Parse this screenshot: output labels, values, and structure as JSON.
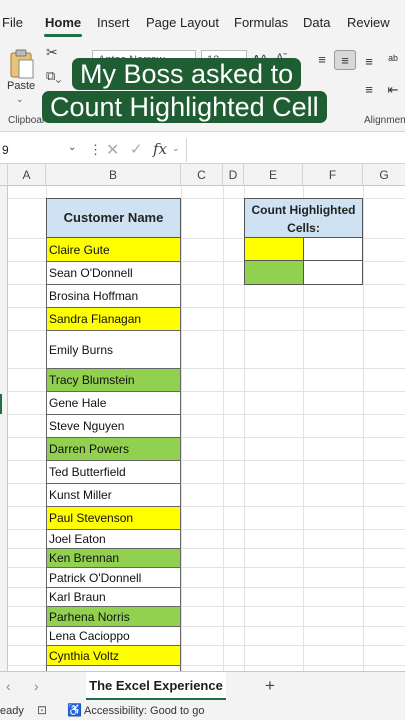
{
  "ribbon_tabs": [
    {
      "label": "File"
    },
    {
      "label": "Home"
    },
    {
      "label": "Insert"
    },
    {
      "label": "Page Layout"
    },
    {
      "label": "Formulas"
    },
    {
      "label": "Data"
    },
    {
      "label": "Review"
    }
  ],
  "active_tab": "Home",
  "ribbon": {
    "paste_label": "Paste",
    "font_name": "Aptos Narrow",
    "font_size": "12",
    "clipboard_label": "Clipboar",
    "alignment_label": "Alignmen"
  },
  "overlay": {
    "line1": "My Boss asked to",
    "line2": "Count Highlighted Cell"
  },
  "formula_bar": {
    "name_box": "9",
    "fx": "fx"
  },
  "columns": [
    "A",
    "B",
    "C",
    "D",
    "E",
    "F",
    "G"
  ],
  "table": {
    "header": "Customer Name",
    "rows": [
      {
        "name": "Claire Gute",
        "fill": "yellow"
      },
      {
        "name": "Sean O'Donnell",
        "fill": "white"
      },
      {
        "name": "Brosina Hoffman",
        "fill": "white"
      },
      {
        "name": "Sandra Flanagan",
        "fill": "yellow"
      },
      {
        "name": "Emily Burns",
        "fill": "white"
      },
      {
        "name": "Tracy Blumstein",
        "fill": "green"
      },
      {
        "name": "Gene Hale",
        "fill": "white"
      },
      {
        "name": "Steve Nguyen",
        "fill": "white"
      },
      {
        "name": "Darren Powers",
        "fill": "green"
      },
      {
        "name": "Ted Butterfield",
        "fill": "white"
      },
      {
        "name": "Kunst Miller",
        "fill": "white"
      },
      {
        "name": "Paul Stevenson",
        "fill": "yellow"
      },
      {
        "name": "Joel Eaton",
        "fill": "white"
      },
      {
        "name": "Ken Brennan",
        "fill": "green"
      },
      {
        "name": "Patrick O'Donnell",
        "fill": "white"
      },
      {
        "name": "Karl Braun",
        "fill": "white"
      },
      {
        "name": "Parhena Norris",
        "fill": "green"
      },
      {
        "name": "Lena Cacioppo",
        "fill": "white"
      },
      {
        "name": "Cynthia Voltz",
        "fill": "yellow"
      }
    ]
  },
  "count_box": {
    "header_line1": "Count Highlighted",
    "header_line2": "Cells:"
  },
  "colors": {
    "yellow": "#ffff00",
    "green": "#92d050",
    "header_blue": "#cfe2f3",
    "overlay_bg": "#1f5e32",
    "accent": "#1e7145"
  },
  "sheet_tab": "The Excel Experience",
  "status": {
    "ready": "eady",
    "accessibility": "Accessibility: Good to go"
  }
}
